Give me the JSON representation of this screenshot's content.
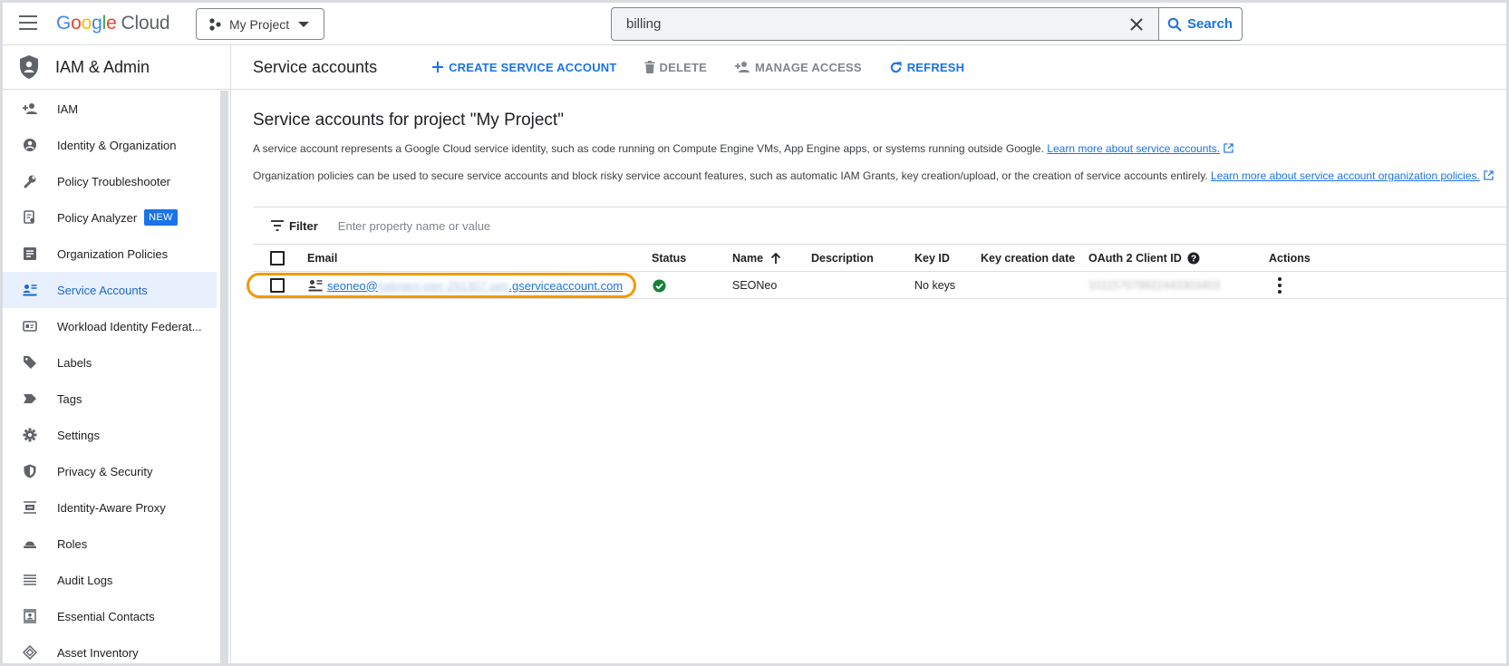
{
  "header": {
    "logo_letters": [
      "G",
      "o",
      "o",
      "g",
      "l",
      "e"
    ],
    "logo_suffix": "Cloud",
    "project": "My Project",
    "search_value": "billing",
    "search_button": "Search"
  },
  "sidebar": {
    "title": "IAM & Admin",
    "items": [
      {
        "label": "IAM",
        "icon": "person-add-icon"
      },
      {
        "label": "Identity & Organization",
        "icon": "account-circle-icon"
      },
      {
        "label": "Policy Troubleshooter",
        "icon": "wrench-icon"
      },
      {
        "label": "Policy Analyzer",
        "icon": "doc-search-icon",
        "badge": "NEW"
      },
      {
        "label": "Organization Policies",
        "icon": "article-icon"
      },
      {
        "label": "Service Accounts",
        "icon": "service-account-icon",
        "active": true
      },
      {
        "label": "Workload Identity Federat...",
        "icon": "badge-icon"
      },
      {
        "label": "Labels",
        "icon": "label-icon"
      },
      {
        "label": "Tags",
        "icon": "tag-arrow-icon"
      },
      {
        "label": "Settings",
        "icon": "gear-icon"
      },
      {
        "label": "Privacy & Security",
        "icon": "shield-icon"
      },
      {
        "label": "Identity-Aware Proxy",
        "icon": "proxy-icon"
      },
      {
        "label": "Roles",
        "icon": "hat-icon"
      },
      {
        "label": "Audit Logs",
        "icon": "list-icon"
      },
      {
        "label": "Essential Contacts",
        "icon": "contact-icon"
      },
      {
        "label": "Asset Inventory",
        "icon": "diamond-icon"
      }
    ]
  },
  "toolbar": {
    "title": "Service accounts",
    "create": "CREATE SERVICE ACCOUNT",
    "delete": "DELETE",
    "manage": "MANAGE ACCESS",
    "refresh": "REFRESH"
  },
  "main": {
    "heading": "Service accounts for project \"My Project\"",
    "desc1": "A service account represents a Google Cloud service identity, such as code running on Compute Engine VMs, App Engine apps, or systems running outside Google.",
    "desc1_link": "Learn more about service accounts.",
    "desc2": "Organization policies can be used to secure service accounts and block risky service account features, such as automatic IAM Grants, key creation/upload, or the creation of service accounts entirely.",
    "desc2_link": "Learn more about service account organization policies.",
    "filter_label": "Filter",
    "filter_placeholder": "Enter property name or value"
  },
  "table": {
    "columns": [
      "Email",
      "Status",
      "Name",
      "Description",
      "Key ID",
      "Key creation date",
      "OAuth 2 Client ID",
      "Actions"
    ],
    "rows": [
      {
        "email_prefix": "seoneo@",
        "email_redacted": "halogen-pier-291307.iam",
        "email_suffix": ".gserviceaccount.com",
        "status": "enabled",
        "name": "SEONeo",
        "description": "",
        "key_id": "No keys",
        "key_creation_date": "",
        "oauth_client_id": "101157079922443303403"
      }
    ]
  },
  "colors": {
    "accent": "#1a73e8",
    "status_ok": "#188038",
    "highlight": "#f29900"
  }
}
